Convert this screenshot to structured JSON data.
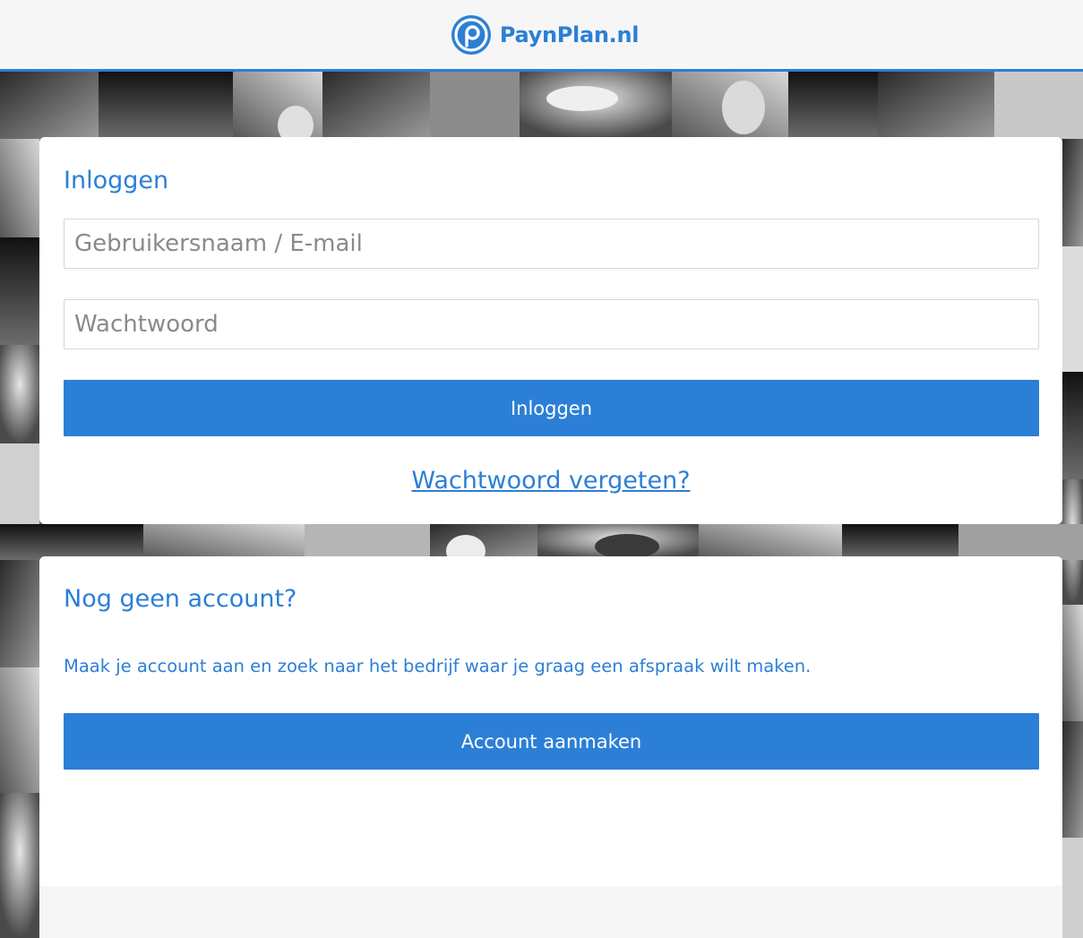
{
  "header": {
    "brand": "PaynPlan.nl",
    "logo_icon": "paynplan-logo-icon"
  },
  "login": {
    "title": "Inloggen",
    "username_placeholder": "Gebruikersnaam / E-mail",
    "username_value": "",
    "password_placeholder": "Wachtwoord",
    "password_value": "",
    "submit_label": "Inloggen",
    "forgot_label": "Wachtwoord vergeten?"
  },
  "register": {
    "title": "Nog geen account?",
    "description": "Maak je account aan en zoek naar het bedrijf waar je graag een afspraak wilt maken.",
    "button_label": "Account aanmaken"
  },
  "colors": {
    "accent": "#2c7fd6",
    "header_bg": "#f6f6f6",
    "card_bg": "#ffffff"
  }
}
